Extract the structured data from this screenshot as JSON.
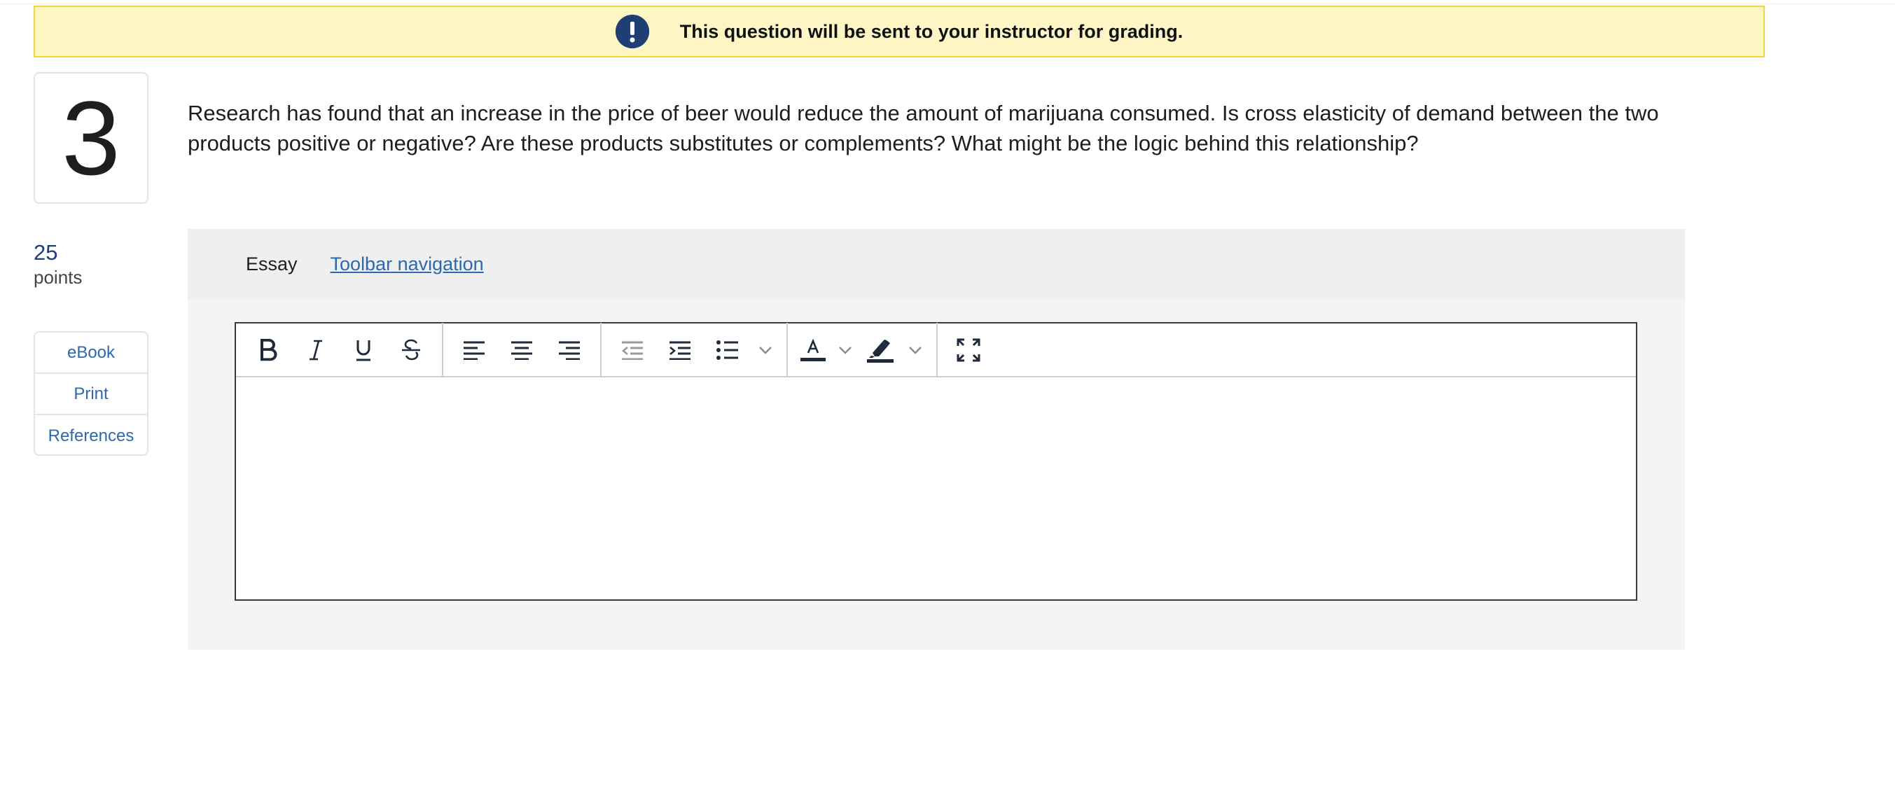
{
  "notice": {
    "text": "This question will be sent to your instructor for grading.",
    "icon": "exclamation-circle-icon",
    "background": "#fdf6c4",
    "border": "#f1d33a"
  },
  "question": {
    "number": "3",
    "text": "Research has found that an increase in the price of beer would reduce the amount of marijuana consumed. Is cross elasticity of demand between the two products positive or negative? Are these products substitutes or complements? What might be the logic behind this relationship?"
  },
  "points": {
    "value": "25",
    "label": "points"
  },
  "sidebar": {
    "links": [
      {
        "label": "eBook"
      },
      {
        "label": "Print"
      },
      {
        "label": "References"
      }
    ]
  },
  "essay": {
    "label": "Essay",
    "toolbar_nav_link": "Toolbar navigation ",
    "content": ""
  },
  "toolbar": {
    "buttons": [
      "bold-icon",
      "italic-icon",
      "underline-icon",
      "strikethrough-icon",
      "align-left-icon",
      "align-center-icon",
      "align-right-icon",
      "outdent-icon",
      "indent-icon",
      "bulleted-list-icon",
      "chevron-down-icon",
      "text-color-icon",
      "chevron-down-icon",
      "highlight-color-icon",
      "chevron-down-icon",
      "fullscreen-icon"
    ]
  },
  "colors": {
    "accent": "#1f3f74",
    "link": "#2e68ad"
  }
}
